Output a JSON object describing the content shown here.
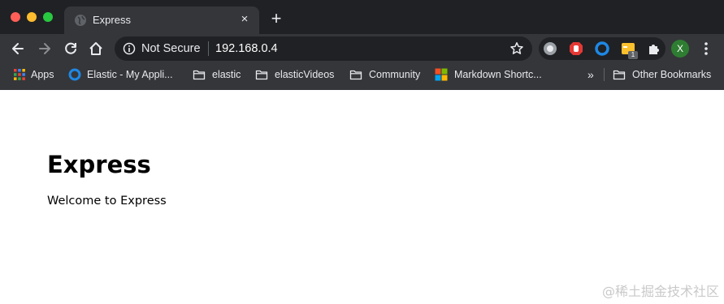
{
  "tab": {
    "title": "Express",
    "close": "×"
  },
  "newtab": "+",
  "omnibox": {
    "security": "Not Secure",
    "url": "192.168.0.4"
  },
  "extensions": {
    "badge": "1"
  },
  "profile": {
    "initial": "X"
  },
  "bookmarks": {
    "items": [
      {
        "label": "Apps"
      },
      {
        "label": "Elastic - My Appli..."
      },
      {
        "label": "elastic"
      },
      {
        "label": "elasticVideos"
      },
      {
        "label": "Community"
      },
      {
        "label": "Markdown Shortc..."
      }
    ],
    "more": "»",
    "other": "Other Bookmarks"
  },
  "page": {
    "heading": "Express",
    "text": "Welcome to Express"
  },
  "watermark": "@稀土掘金技术社区",
  "colors": {
    "chrome": "#35363a",
    "tabstrip": "#202124",
    "omnibox": "#202124",
    "text": "#e8eaed"
  }
}
